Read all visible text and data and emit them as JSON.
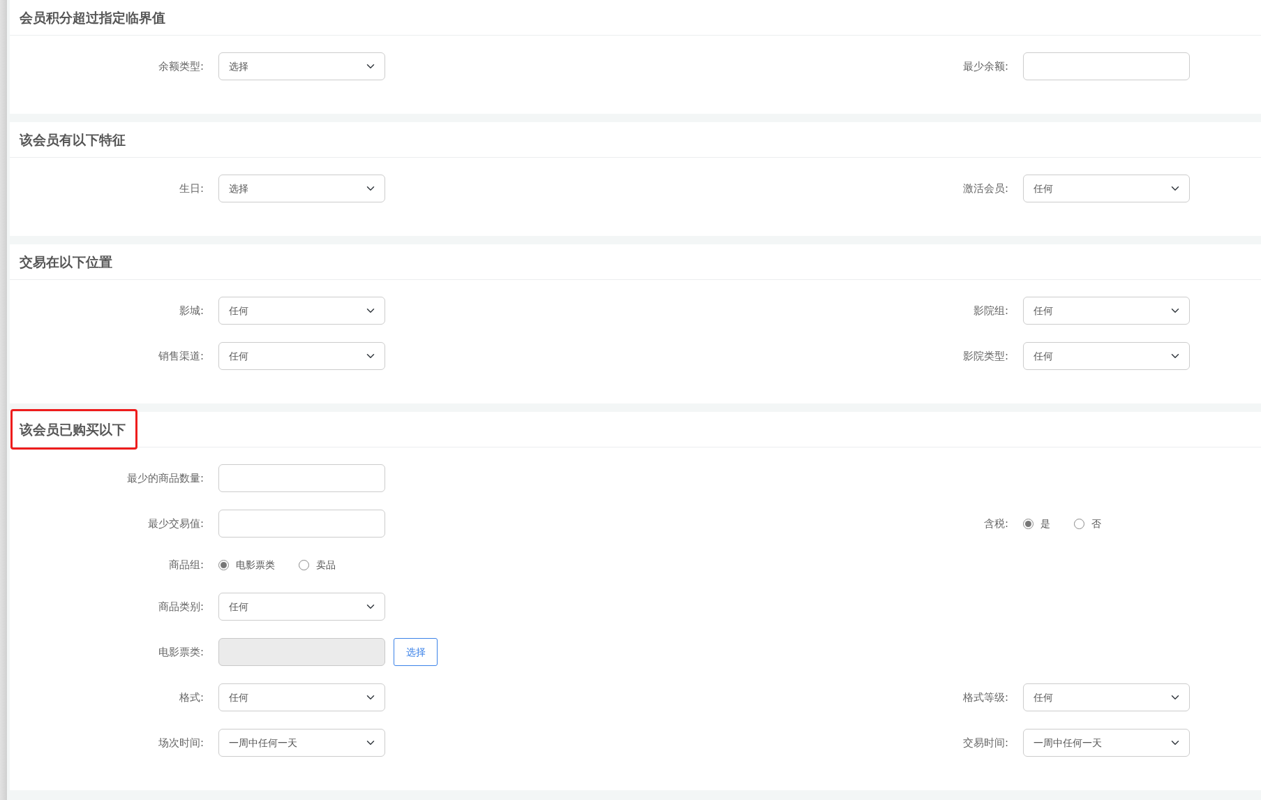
{
  "sections": [
    {
      "title": "会员积分超过指定临界值",
      "highlighted": false,
      "rows": [
        {
          "left": {
            "kind": "select",
            "label": "余额类型:",
            "value": "选择"
          },
          "right": {
            "kind": "input",
            "label": "最少余额:"
          }
        }
      ]
    },
    {
      "title": "该会员有以下特征",
      "highlighted": false,
      "rows": [
        {
          "left": {
            "kind": "select",
            "label": "生日:",
            "value": "选择"
          },
          "right": {
            "kind": "select",
            "label": "激活会员:",
            "value": "任何"
          }
        }
      ]
    },
    {
      "title": "交易在以下位置",
      "highlighted": false,
      "rows": [
        {
          "left": {
            "kind": "select",
            "label": "影城:",
            "value": "任何"
          },
          "right": {
            "kind": "select",
            "label": "影院组:",
            "value": "任何"
          }
        },
        {
          "left": {
            "kind": "select",
            "label": "销售渠道:",
            "value": "任何"
          },
          "right": {
            "kind": "select",
            "label": "影院类型:",
            "value": "任何"
          }
        }
      ]
    },
    {
      "title": "该会员已购买以下",
      "highlighted": true,
      "rows": [
        {
          "left": {
            "kind": "input",
            "label": "最少的商品数量:"
          }
        },
        {
          "left": {
            "kind": "input",
            "label": "最少交易值:"
          },
          "right": {
            "kind": "radio",
            "label": "含税:",
            "options": [
              {
                "label": "是",
                "selected": true
              },
              {
                "label": "否",
                "selected": false
              }
            ]
          }
        },
        {
          "left": {
            "kind": "radio",
            "label": "商品组:",
            "options": [
              {
                "label": "电影票类",
                "selected": true
              },
              {
                "label": "卖品",
                "selected": false
              }
            ]
          }
        },
        {
          "left": {
            "kind": "select",
            "label": "商品类别:",
            "value": "任何"
          }
        },
        {
          "left": {
            "kind": "picker",
            "label": "电影票类:",
            "disabled": true,
            "button": "选择"
          }
        },
        {
          "left": {
            "kind": "select",
            "label": "格式:",
            "value": "任何"
          },
          "right": {
            "kind": "select",
            "label": "格式等级:",
            "value": "任何"
          }
        },
        {
          "left": {
            "kind": "select",
            "label": "场次时间:",
            "value": "一周中任何一天"
          },
          "right": {
            "kind": "select",
            "label": "交易时间:",
            "value": "一周中任何一天"
          }
        }
      ]
    }
  ]
}
